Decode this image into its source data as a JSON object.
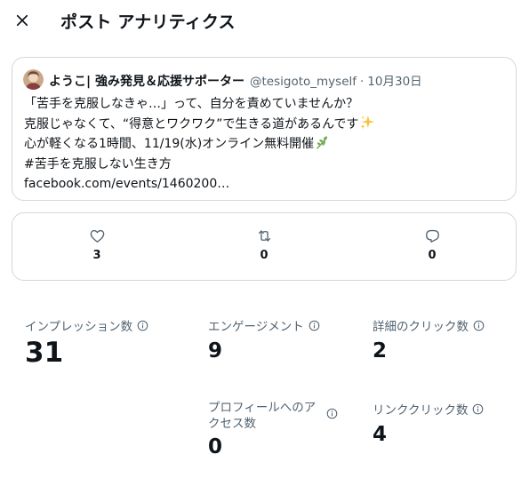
{
  "header": {
    "title": "ポスト アナリティクス",
    "close_icon": "close-icon"
  },
  "tweet": {
    "author_name": "ようこ| 強み発見＆応援サポーター",
    "handle": "@tesigoto_myself",
    "separator": "·",
    "date": "10月30日",
    "lines": [
      "「苦手を克服しなきゃ…」って、自分を責めていませんか？",
      "克服じゃなくて、“得意とワクワク”で生きる道があるんです",
      "心が軽くなる1時間、11/19(水)オンライン無料開催",
      "#苦手を克服しない生き方"
    ],
    "link": "facebook.com/events/1460200…",
    "emojis": [
      "sparkles-emoji",
      "herb-emoji"
    ]
  },
  "engagement": {
    "likes": {
      "icon": "heart-icon",
      "count": "3"
    },
    "reposts": {
      "icon": "repost-icon",
      "count": "0"
    },
    "replies": {
      "icon": "reply-icon",
      "count": "0"
    }
  },
  "metrics": {
    "impressions": {
      "label": "インプレッション数",
      "value": "31"
    },
    "engagements": {
      "label": "エンゲージメント",
      "value": "9"
    },
    "detail_clicks": {
      "label": "詳細のクリック数",
      "value": "2"
    },
    "profile_visits": {
      "label_line1": "プロフィールへのア",
      "label_line2": "クセス数",
      "value": "0"
    },
    "link_clicks": {
      "label": "リンククリック数",
      "value": "4"
    }
  },
  "colors": {
    "text_primary": "#0f1419",
    "text_secondary": "#536471",
    "border": "#cfd9de"
  }
}
